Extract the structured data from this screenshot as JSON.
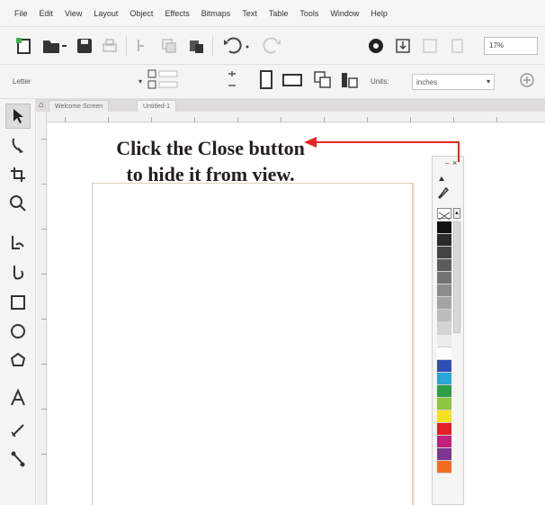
{
  "menu": {
    "items": [
      "File",
      "Edit",
      "View",
      "Layout",
      "Object",
      "Effects",
      "Bitmaps",
      "Text",
      "Table",
      "Tools",
      "Window",
      "Help"
    ]
  },
  "standard_toolbar": {
    "zoom_value": "17%"
  },
  "property_bar": {
    "paper_preset": "Letter",
    "units_label": "Units:",
    "units_value": "inches"
  },
  "document_tabs": {
    "welcome_label": "Welcome Screen",
    "document_label": "Untitled-1"
  },
  "palette": {
    "close_glyph": "×",
    "minimize_glyph": "–",
    "scroll_up_glyph": "▲",
    "swatch_colors": [
      "#111111",
      "#2b2b2b",
      "#444444",
      "#5c5c5c",
      "#747474",
      "#8c8c8c",
      "#a4a4a4",
      "#bcbcbc",
      "#d4d4d4",
      "#ececec",
      "#ffffff",
      "#2f4fb5",
      "#27a7d8",
      "#2e9d47",
      "#8dc63f",
      "#f7e01d",
      "#e21f26",
      "#c1207d",
      "#7d3594",
      "#f26b21"
    ]
  },
  "callout": {
    "text": "Click the Close button to hide it from view.",
    "arrow_color": "#e32726"
  }
}
